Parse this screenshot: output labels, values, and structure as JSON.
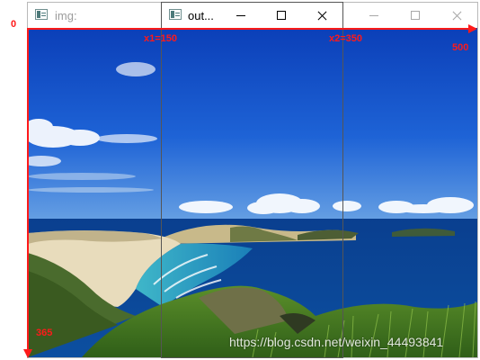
{
  "windows": {
    "background": {
      "title": "img:"
    },
    "foreground": {
      "title": "out..."
    }
  },
  "annotations": {
    "origin_label": "0",
    "x1_label": "x1=150",
    "x2_label": "x2=350",
    "width_label": "500",
    "height_label": "365",
    "color": "#ff1a1a"
  },
  "watermark": {
    "text": "https://blog.csdn.net/weixin_44493841"
  },
  "icons": {
    "app_icon": "image-window-icon",
    "minimize": "minimize-icon",
    "maximize": "maximize-icon",
    "close": "close-icon"
  }
}
